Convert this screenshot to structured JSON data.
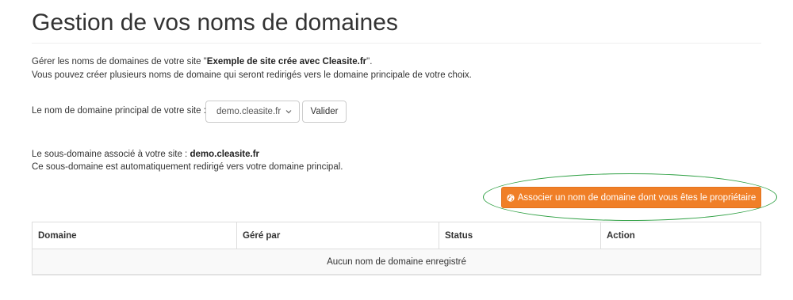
{
  "page_title": "Gestion de vos noms de domaines",
  "intro": {
    "line1_prefix": "Gérer les noms de domaines de votre site \"",
    "site_name": "Exemple de site crée avec Cleasite.fr",
    "line1_suffix": "\".",
    "line2": "Vous pouvez créer plusieurs noms de domaine qui seront redirigés vers le domaine principale de votre choix."
  },
  "main_domain": {
    "label": "Le nom de domaine principal de votre site :",
    "selected": "demo.cleasite.fr",
    "submit_label": "Valider"
  },
  "subdomain": {
    "label": "Le sous-domaine associé à votre site :",
    "value": "demo.cleasite.fr",
    "note": "Ce sous-domaine est automatiquement redirigé vers votre domaine principal."
  },
  "associate_button": {
    "label": "Associer un nom de domaine dont vous êtes le propriétaire",
    "icon": "globe-icon",
    "color": "#f07f27"
  },
  "highlight_color": "#2ea043",
  "table": {
    "columns": [
      "Domaine",
      "Géré par",
      "Status",
      "Action"
    ],
    "empty_message": "Aucun nom de domaine enregistré"
  }
}
